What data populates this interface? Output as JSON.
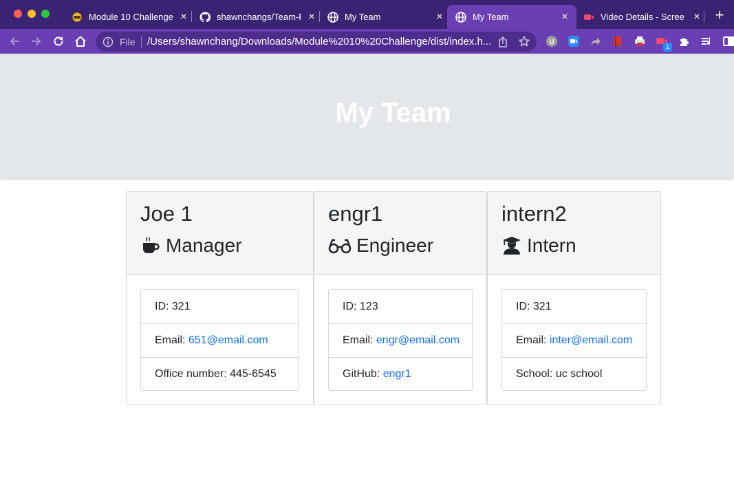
{
  "browser": {
    "tabs": [
      {
        "title": "Module 10 Challenge",
        "favicon": "module-logo-icon",
        "active": false
      },
      {
        "title": "shawnchangs/Team-P",
        "favicon": "github-icon",
        "active": false
      },
      {
        "title": "My Team",
        "favicon": "globe-icon",
        "active": false
      },
      {
        "title": "My Team",
        "favicon": "globe-icon",
        "active": true
      },
      {
        "title": "Video Details - Scree",
        "favicon": "video-icon",
        "active": false
      }
    ],
    "close_glyph": "×",
    "new_tab_glyph": "+",
    "address": {
      "scheme_label": "File",
      "url": "/Users/shawnchang/Downloads/Module%2010%20Challenge/dist/index.h..."
    },
    "extensions_badge": "1",
    "accent_colors": {
      "tabbar": "#3a2373",
      "toolbar": "#6a3fb4",
      "active_tab": "#6a3fb4"
    }
  },
  "page": {
    "title": "My Team",
    "jumbotron_color": "#e4e7ea",
    "link_color": "#0d6efd"
  },
  "employees": [
    {
      "name": "Joe 1",
      "role": "Manager",
      "role_icon": "coffee-mug-icon",
      "id_label": "ID:",
      "id": "321",
      "email_label": "Email:",
      "email": "651@email.com",
      "extra_label": "Office number:",
      "extra": "445-6545"
    },
    {
      "name": "engr1",
      "role": "Engineer",
      "role_icon": "glasses-icon",
      "id_label": "ID:",
      "id": "123",
      "email_label": "Email:",
      "email": "engr@email.com",
      "extra_label": "GitHub:",
      "extra": "engr1"
    },
    {
      "name": "intern2",
      "role": "Intern",
      "role_icon": "graduate-icon",
      "id_label": "ID:",
      "id": "321",
      "email_label": "Email:",
      "email": "inter@email.com",
      "extra_label": "School:",
      "extra": "uc school"
    }
  ]
}
